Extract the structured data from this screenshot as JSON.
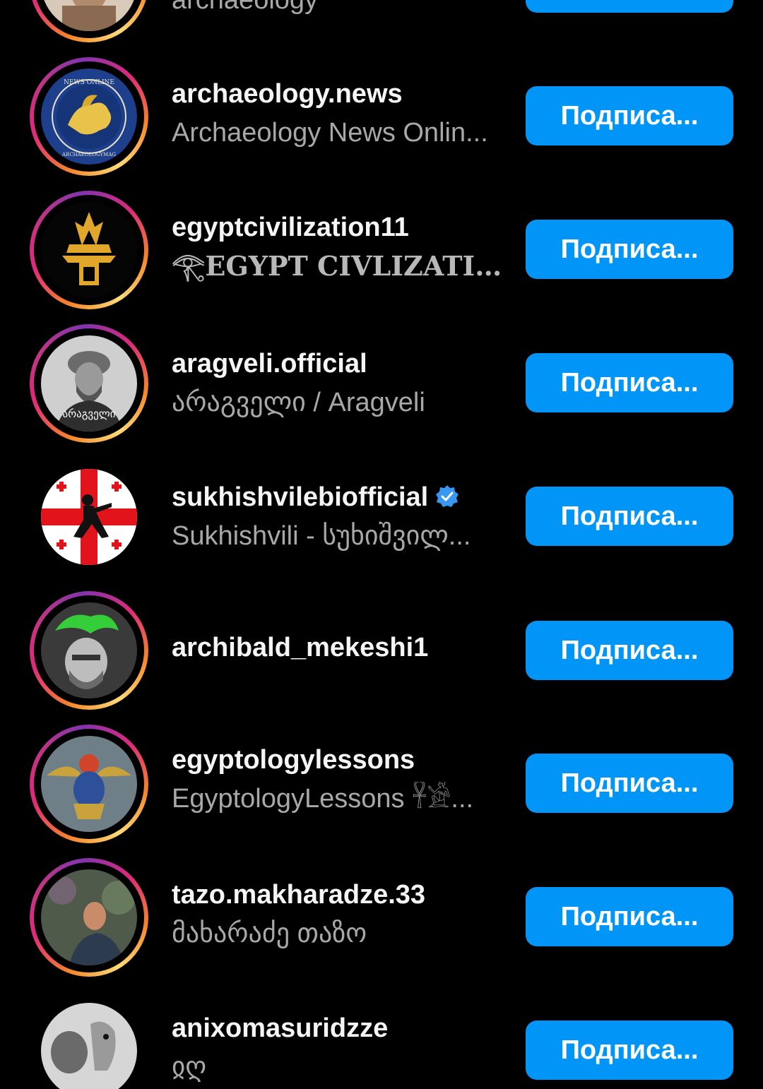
{
  "follow_label": "Подписа...",
  "colors": {
    "background": "#000000",
    "button": "#0095f6",
    "username": "#f5f5f5",
    "secondary": "#a8a8a8",
    "verified": "#3897f0"
  },
  "partial_top": {
    "fullname": "archaeology"
  },
  "accounts": [
    {
      "username": "archaeology.news",
      "fullname": "Archaeology News Onlin...",
      "story_ring": true
    },
    {
      "username": "egyptcivilization11",
      "fullname": "𓂀EGYPT CIVLIZATIO...",
      "story_ring": true
    },
    {
      "username": "aragveli.official",
      "fullname": "არაგველი / Aragveli",
      "story_ring": true
    },
    {
      "username": "sukhishvilebiofficial",
      "fullname": "Sukhishvili - სუხიშვილ...",
      "story_ring": false,
      "verified": true
    },
    {
      "username": "archibald_mekeshi1",
      "fullname": "",
      "story_ring": true
    },
    {
      "username": "egyptologylessons",
      "fullname": "EgyptologyLessons 𓋹𓀀...",
      "story_ring": true
    },
    {
      "username": "tazo.makharadze.33",
      "fullname": "მახარაძე თაზო",
      "story_ring": true
    },
    {
      "username": "anixomasuridzze",
      "fullname": "ჲღ",
      "story_ring": false
    }
  ]
}
